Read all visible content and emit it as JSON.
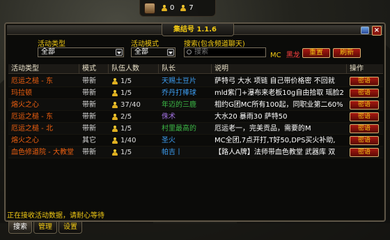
{
  "topbar": {
    "players": "0",
    "groups": "7"
  },
  "window": {
    "title": "集结号 1.1.6",
    "close": "×"
  },
  "filters": {
    "type_label": "活动类型",
    "type_value": "全部",
    "mode_label": "活动模式",
    "mode_value": "全部",
    "search_label": "搜索(包含频道聊天)",
    "search_placeholder": "搜索",
    "mc_label": "MC",
    "mc_value": "黑龙",
    "reset": "重置",
    "refresh": "刷新"
  },
  "columns": [
    "活动类型",
    "模式",
    "队伍人数",
    "队长",
    "说明",
    "操作"
  ],
  "rows": [
    {
      "type": "厄运之槌 - 东",
      "mode": "带新",
      "size": "1/5",
      "leader": "天赐土豆片",
      "leader_color": "#3c9cf0",
      "desc": "萨特弓 大水 项链 自己带价格密 不回就",
      "op": "密语"
    },
    {
      "type": "玛拉顿",
      "mode": "带新",
      "size": "1/5",
      "leader": "乔丹打棒球",
      "leader_color": "#3c9cf0",
      "desc": "mld紫门+瀑布来老板10g自由拾取 瑶脸2",
      "op": "密语"
    },
    {
      "type": "熔火之心",
      "mode": "带新",
      "size": "37/40",
      "leader": "年迈的三鹿",
      "leader_color": "#3cb846",
      "desc": "相约G团MC所有100起，同职业第二60%",
      "op": "密语"
    },
    {
      "type": "厄运之槌 - 东",
      "mode": "带新",
      "size": "2/5",
      "leader": "侏术",
      "leader_color": "#a070e0",
      "desc": "大水20 暴雨30 萨特50",
      "op": "密语"
    },
    {
      "type": "厄运之槌 - 北",
      "mode": "带新",
      "size": "1/5",
      "leader": "村里最高的",
      "leader_color": "#3cb846",
      "desc": "厄运老一，完美贡品，需要的M",
      "op": "密语"
    },
    {
      "type": "熔火之心",
      "mode": "其它",
      "size": "1/40",
      "leader": "圣火",
      "leader_color": "#3c9cf0",
      "desc": "MC全团,7点开打,T好50,DPS买火补助,",
      "op": "密语"
    },
    {
      "type": "血色修道院 - 大教堂",
      "mode": "带新",
      "size": "1/5",
      "leader": "帕吉丨",
      "leader_color": "#3c9cf0",
      "desc": "【路人A牌】法师带血色教堂 武器库 双",
      "op": "密语"
    }
  ],
  "status": "正在接收活动数据，请耐心等待",
  "tabs": [
    "搜索",
    "管理",
    "设置"
  ]
}
